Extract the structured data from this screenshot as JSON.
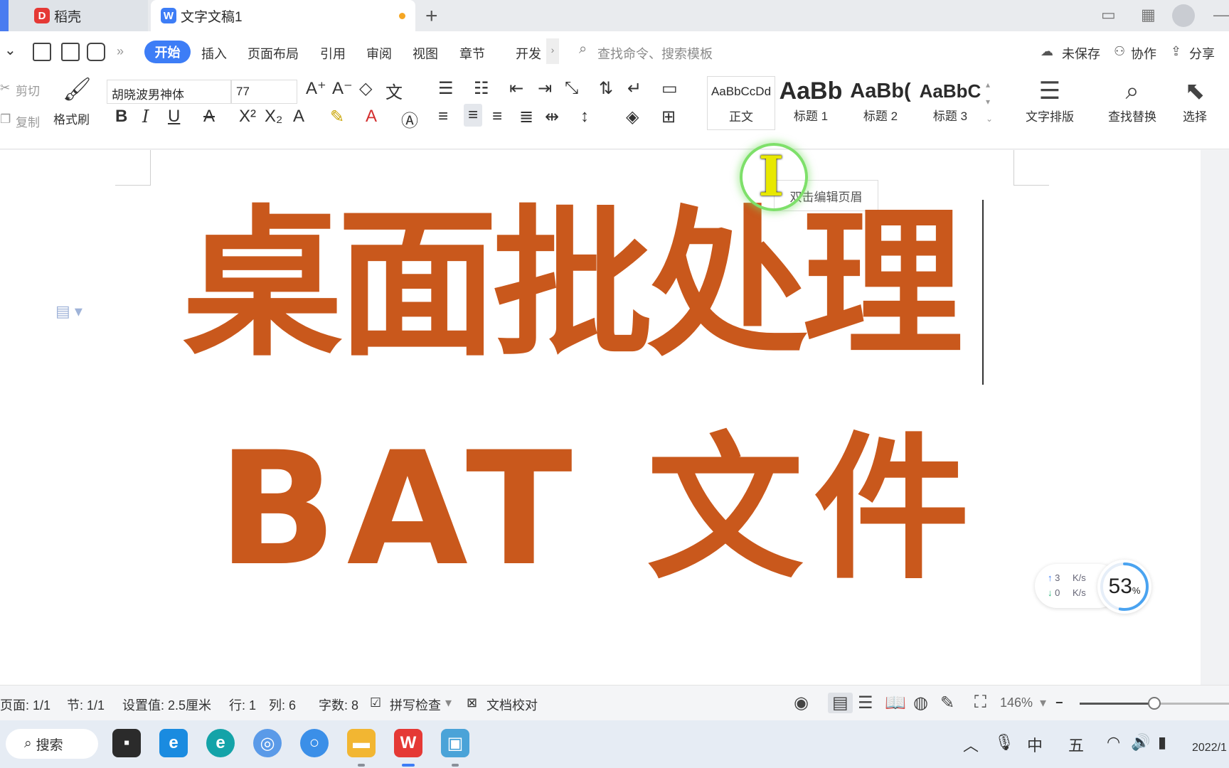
{
  "tabs": [
    {
      "label": "稻壳",
      "logo": "daoke-logo",
      "color": "#e53935"
    },
    {
      "label": "文字文稿1",
      "logo": "wps-writer-logo",
      "color": "#3d7df6",
      "unsaved": true
    }
  ],
  "menu": {
    "items": [
      "开始",
      "插入",
      "页面布局",
      "引用",
      "审阅",
      "视图",
      "章节",
      "开发"
    ],
    "search_placeholder": "查找命令、搜索模板",
    "right": [
      "未保存",
      "协作",
      "分享"
    ]
  },
  "ribbon": {
    "cut": "剪切",
    "copy": "复制",
    "format_painter": "格式刷",
    "font_name": "胡晓波男神体",
    "font_size": "77",
    "styles": [
      {
        "preview": "AaBbCcDd",
        "label": "正文"
      },
      {
        "preview": "AaBb",
        "label": "标题 1"
      },
      {
        "preview": "AaBb(",
        "label": "标题 2"
      },
      {
        "preview": "AaBbC",
        "label": "标题 3"
      }
    ],
    "text_layout": "文字排版",
    "find_replace": "查找替换",
    "select": "选择"
  },
  "document": {
    "header_hint": "双击编辑页眉",
    "line1": "桌面批处理",
    "line2": "BAT 文件",
    "text_color": "#c9581c"
  },
  "speed_widget": {
    "upload": "3",
    "download": "0",
    "unit": "K/s",
    "percent": "53",
    "percent_sign": "%"
  },
  "status": {
    "page": "页面: 1/1",
    "section": "节: 1/1",
    "setting": "设置值: 2.5厘米",
    "row": "行: 1",
    "col": "列: 6",
    "word_count": "字数: 8",
    "spell_check": "拼写检查",
    "doc_check": "文档校对",
    "zoom": "146%",
    "zoom_level": 0.5
  },
  "taskbar": {
    "search": "搜索",
    "ime": "中",
    "ime2": "五",
    "date": "2022/1"
  }
}
